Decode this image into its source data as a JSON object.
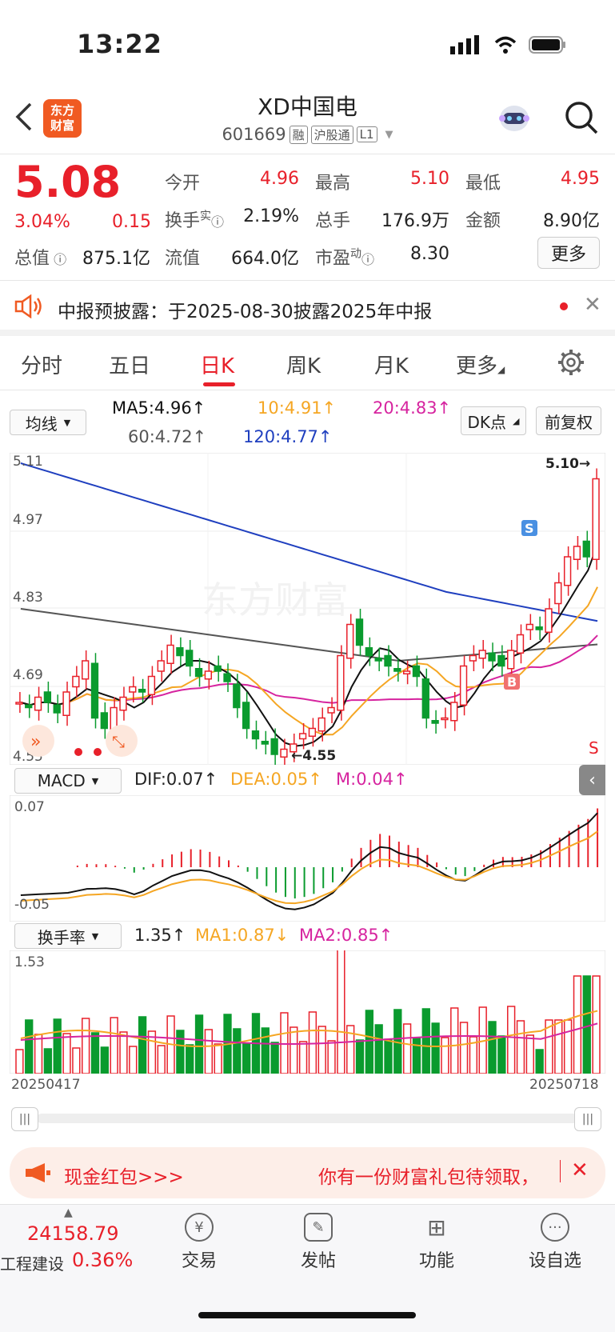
{
  "status": {
    "time": "13:22"
  },
  "header": {
    "logo_text": "东方\n财富",
    "title": "XD中国电",
    "code": "601669",
    "tags": [
      "融",
      "沪股通",
      "L1"
    ]
  },
  "quote": {
    "price": "5.08",
    "change_pct": "3.04%",
    "change": "0.15",
    "open_label": "今开",
    "open": "4.96",
    "high_label": "最高",
    "high": "5.10",
    "low_label": "最低",
    "low": "4.95",
    "turnover_label": "换手",
    "turnover_sup": "实",
    "turnover": "2.19%",
    "volume_label": "总手",
    "volume": "176.9万",
    "amount_label": "金额",
    "amount": "8.90亿",
    "mktcap_label": "总值",
    "mktcap": "875.1亿",
    "float_label": "流值",
    "float": "664.0亿",
    "pe_label": "市盈",
    "pe_sup": "动",
    "pe": "8.30",
    "more_label": "更多"
  },
  "notice": {
    "text": "中报预披露：于2025-08-30披露2025年中报"
  },
  "tabs": [
    "分时",
    "五日",
    "日K",
    "周K",
    "月K",
    "更多"
  ],
  "active_tab": "日K",
  "ma": {
    "selector": "均线",
    "ma5": "MA5:4.96↑",
    "ma10": "10:4.91↑",
    "ma20": "20:4.83↑",
    "ma60": "60:4.72↑",
    "ma120": "120:4.77↑",
    "dk_label": "DK点",
    "adj_label": "前复权"
  },
  "kline": {
    "y_ticks": [
      "5.11",
      "4.97",
      "4.83",
      "4.69",
      "4.55"
    ],
    "high_marker": "5.10→",
    "low_marker": "←4.55",
    "watermark": "东方财富",
    "signal_s": "S",
    "signal_b": "B",
    "edge_s": "S"
  },
  "macd": {
    "selector": "MACD",
    "dif": "DIF:0.07↑",
    "dea": "DEA:0.05↑",
    "m": "M:0.04↑",
    "top": "0.07",
    "bottom": "-0.05"
  },
  "turnover_panel": {
    "selector": "换手率",
    "value": "1.35↑",
    "ma1": "MA1:0.87↓",
    "ma2": "MA2:0.85↑",
    "top": "1.53",
    "date_start": "20250417",
    "date_end": "20250718"
  },
  "promo": {
    "left": "现金红包>>>",
    "right": "你有一份财富礼包待领取，"
  },
  "bottom_nav": {
    "index_value": "24158.79",
    "index_name": "工程建设",
    "index_pct": "0.36%",
    "items": [
      "交易",
      "发帖",
      "功能",
      "设自选"
    ]
  },
  "colors": {
    "up": "#e8202a",
    "down": "#0a9b2e",
    "ma5": "#111111",
    "ma10": "#f5a623",
    "ma20": "#d6249f",
    "ma60": "#555555",
    "ma120": "#1f3fbf"
  }
}
